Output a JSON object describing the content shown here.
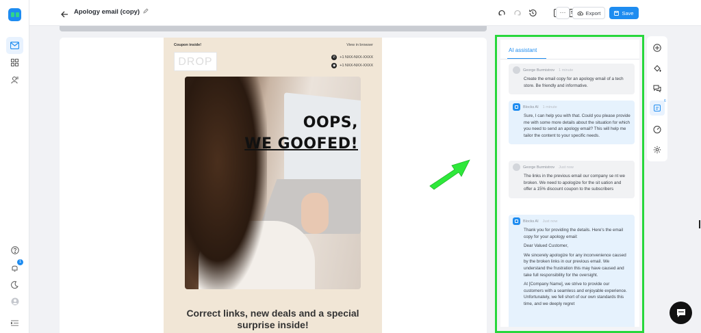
{
  "window": {
    "title": "Apology email (copy)"
  },
  "toolbar": {
    "more_label": "···",
    "export_label": "Export",
    "save_label": "Save"
  },
  "left_rail": {
    "notification_count": "1"
  },
  "email": {
    "coupon_text": "Coupon inside!",
    "view_in_browser": "View in browser",
    "logo_text": "DROP",
    "phone_1": "+1 NXX-NXX-XXXX",
    "phone_2": "+1 NXX-NXX-XXXX",
    "hero_line_1": "OOPS,",
    "hero_line_2": "WE GOOFED!",
    "headline": "Correct links, new deals and a special surprise inside!"
  },
  "assistant": {
    "tab_label": "AI assistant",
    "messages": [
      {
        "author": "George Burmistrov",
        "time": "1 minute",
        "role": "user",
        "paragraphs": [
          "Create the email copy for an apology email of a tech store. Be friendly and informative."
        ]
      },
      {
        "author": "Blocks AI",
        "time": "1 minute",
        "role": "ai",
        "paragraphs": [
          "Sure, I can help you with that. Could you please provide me with some more details about the situation for which you need to send an apology email? This will help me tailor the content to your specific needs."
        ]
      },
      {
        "author": "George Burmistrov",
        "time": "Just now",
        "role": "user",
        "paragraphs": [
          "The links in the previous email our company se nt we broken. We need to apologize for the sit uation and offer a 15% discount coupon to the  subscribers"
        ]
      },
      {
        "author": "Blocks AI",
        "time": "Just now",
        "role": "ai",
        "paragraphs": [
          "Thank you for providing the details. Here's the email copy for your apology email:",
          "Dear Valued Customer,",
          "We sincerely apologize for any inconvenience caused by the broken links in our previous email. We understand the frustration this may have caused and take full responsibility for the oversight.",
          "At [Company Name], we strive to provide our customers with a seamless and enjoyable experience. Unfortunately, we fell short of our own standards this time, and we deeply regret"
        ]
      }
    ]
  },
  "right_tools": {
    "settings_badge": "6"
  },
  "colors": {
    "accent": "#1e8cf0",
    "highlight_border": "#27d73b",
    "arrow": "#2ee83a"
  }
}
